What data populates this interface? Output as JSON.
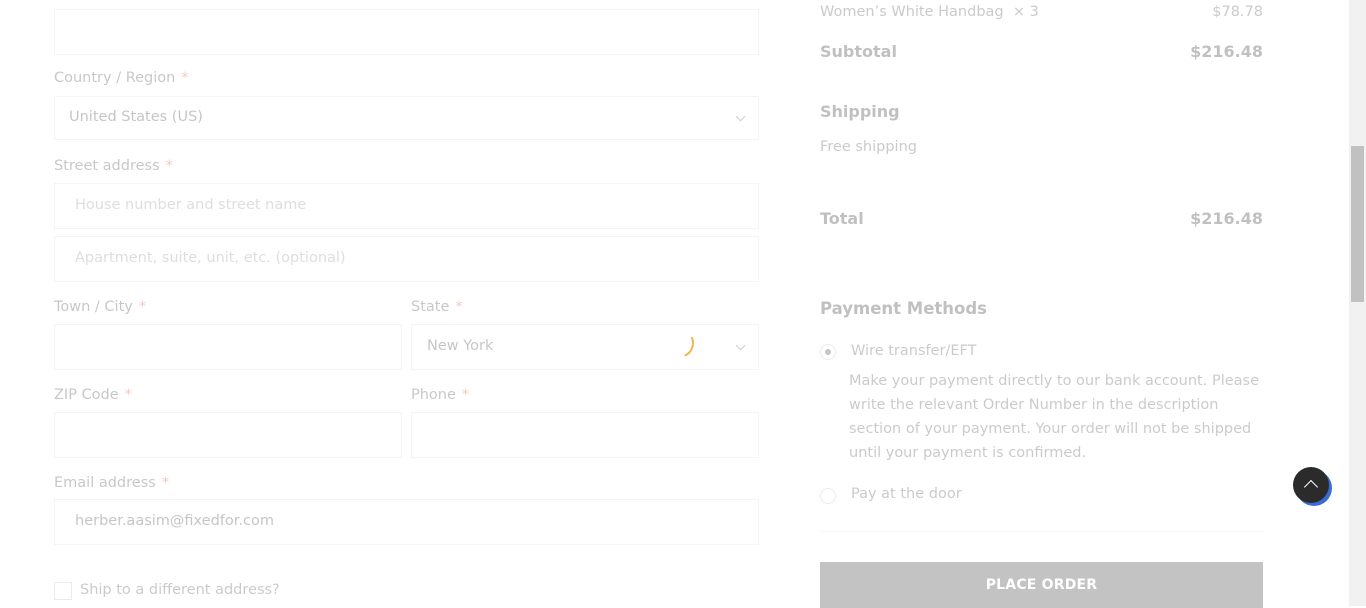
{
  "billing": {
    "country_label": "Country / Region",
    "country_value": "United States (US)",
    "street_label": "Street address",
    "street_placeholder": "House number and street name",
    "apartment_placeholder": "Apartment, suite, unit, etc. (optional)",
    "city_label": "Town / City",
    "state_label": "State",
    "state_value": "New York",
    "zip_label": "ZIP Code",
    "phone_label": "Phone",
    "email_label": "Email address",
    "email_value": "herber.aasim@fixedfor.com",
    "required_mark": "*",
    "ship_different_label": "Ship to a different address?"
  },
  "order": {
    "item_name": "Women’s White Handbag",
    "item_qty": "× 3",
    "item_price": "$78.78",
    "subtotal_label": "Subtotal",
    "subtotal_value": "$216.48",
    "shipping_label": "Shipping",
    "shipping_method": "Free shipping",
    "total_label": "Total",
    "total_value": "$216.48"
  },
  "payment": {
    "title": "Payment Methods",
    "methods": [
      {
        "label": "Wire transfer/EFT",
        "selected": true
      },
      {
        "label": "Pay at the door",
        "selected": false
      }
    ],
    "wire_description": "Make your payment directly to our bank account. Please write the relevant Order Number in the description section of your payment. Your order will not be shipped until your payment is confirmed.",
    "place_order_label": "PLACE ORDER"
  },
  "icons": {
    "back_to_top": "chevron-up-icon",
    "loading": "spinner-icon",
    "select_arrow": "chevron-down-icon"
  },
  "colors": {
    "required": "#e2401c",
    "button": "#2b2b2b",
    "spinner": "#f2b44a",
    "accent_ring": "#3a6cd6"
  }
}
